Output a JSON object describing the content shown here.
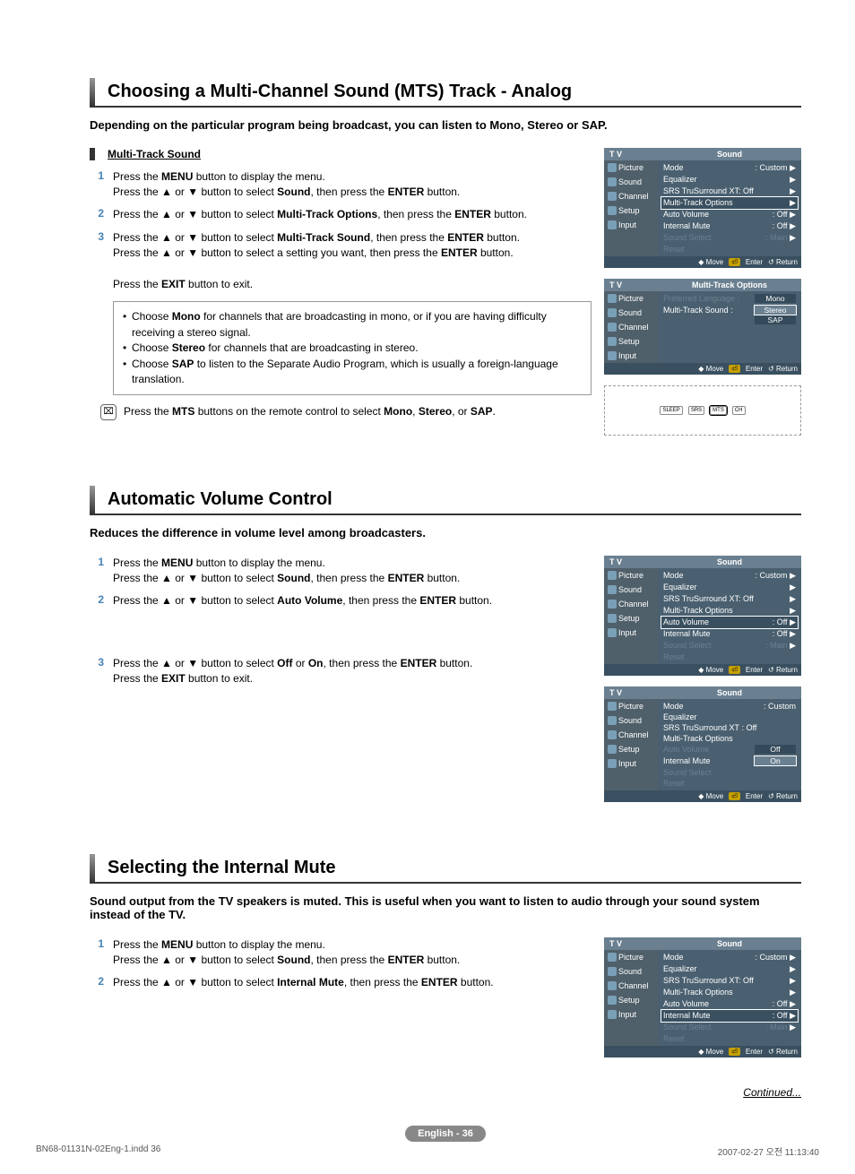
{
  "sectionA": {
    "title": "Choosing a Multi-Channel Sound (MTS) Track - Analog",
    "intro": "Depending on the particular program being broadcast, you can listen to Mono, Stereo or SAP.",
    "subTitle": "Multi-Track Sound",
    "step1a": "Press the ",
    "step1b": " button to display the menu.",
    "step1c": "Press the ▲ or ▼ button to select ",
    "step1d": ", then press the ",
    "step1e": " button.",
    "step2a": "Press the ▲ or ▼ button to select ",
    "step2b": ", then press the ",
    "step2c": " button.",
    "step3a": "Press the ▲ or ▼ button to select ",
    "step3b": ", then press the ",
    "step3c": " button.",
    "step3d": "Press the ▲ or ▼ button to select a setting you want, then press the ",
    "step3e": " button.",
    "exit": "Press the ",
    "exit2": " button to exit.",
    "note1a": "Choose ",
    "note1b": " for channels that are broadcasting in mono, or if you are having difficulty receiving a stereo signal.",
    "note2a": "Choose ",
    "note2b": " for channels that are broadcasting in stereo.",
    "note3a": "Choose ",
    "note3b": " to listen to the Separate Audio Program, which is usually a foreign-language translation.",
    "remote": "Press the ",
    "remote2": " buttons on the remote control to select ",
    "remote3": ", ",
    "remote4": ", or ",
    "remote5": "."
  },
  "bold": {
    "MENU": "MENU",
    "Sound": "Sound",
    "ENTER": "ENTER",
    "EXIT": "EXIT",
    "MultiTrackOptions": "Multi-Track Options",
    "MultiTrackSound": "Multi-Track Sound",
    "Mono": "Mono",
    "Stereo": "Stereo",
    "SAP": "SAP",
    "MTS": "MTS",
    "AutoVolume": "Auto Volume",
    "Off": "Off",
    "On": "On",
    "InternalMute": "Internal Mute"
  },
  "sectionB": {
    "title": "Automatic Volume Control",
    "intro": "Reduces the difference in volume level among broadcasters.",
    "step1a": "Press the ",
    "step1b": " button to display the menu.",
    "step1c": "Press the ▲ or ▼ button to select ",
    "step1d": ", then press the ",
    "step1e": " button.",
    "step2a": "Press the ▲ or ▼ button to select ",
    "step2b": ", then press the ",
    "step2c": " button.",
    "step3a": "Press the ▲ or ▼ button to select ",
    "step3b": " or ",
    "step3c": ", then press the ",
    "step3d": " button.",
    "step3e": "Press the ",
    "step3f": " button to exit."
  },
  "sectionC": {
    "title": "Selecting the Internal Mute",
    "intro": "Sound output from the TV speakers is muted. This is useful when you want to listen to audio through your sound system instead of the TV.",
    "step1a": "Press the ",
    "step1b": " button to display the menu.",
    "step1c": "Press the ▲ or ▼ button to select ",
    "step1d": ", then press the ",
    "step1e": " button.",
    "step2a": "Press the ▲ or ▼ button to select ",
    "step2b": ", then press the ",
    "step2c": " button."
  },
  "continued": "Continued...",
  "pageNum": "English - 36",
  "footer": {
    "left": "BN68-01131N-02Eng-1.indd   36",
    "right": "2007-02-27   오전 11:13:40"
  },
  "osd": {
    "tv": "T V",
    "soundTitle": "Sound",
    "mtTitle": "Multi-Track Options",
    "side": [
      "Picture",
      "Sound",
      "Channel",
      "Setup",
      "Input"
    ],
    "mode": "Mode",
    "custom": ": Custom",
    "eq": "Equalizer",
    "srs": "SRS TruSurround XT: Off",
    "srs2": "SRS TruSurround XT",
    "mto": "Multi-Track Options",
    "av": "Auto Volume",
    "off": ": Off",
    "im": "Internal Mute",
    "ss": "Sound Select",
    "main": ": Main",
    "reset": "Reset",
    "pref": "Preferred Language :",
    "mts": "Multi-Track Sound :",
    "mono": "Mono",
    "stereo": "Stereo",
    "sap": "SAP",
    "ftrMove": "Move",
    "ftrEnter": "Enter",
    "ftrReturn": "Return",
    "optOff": "Off",
    "optOn": "On"
  }
}
